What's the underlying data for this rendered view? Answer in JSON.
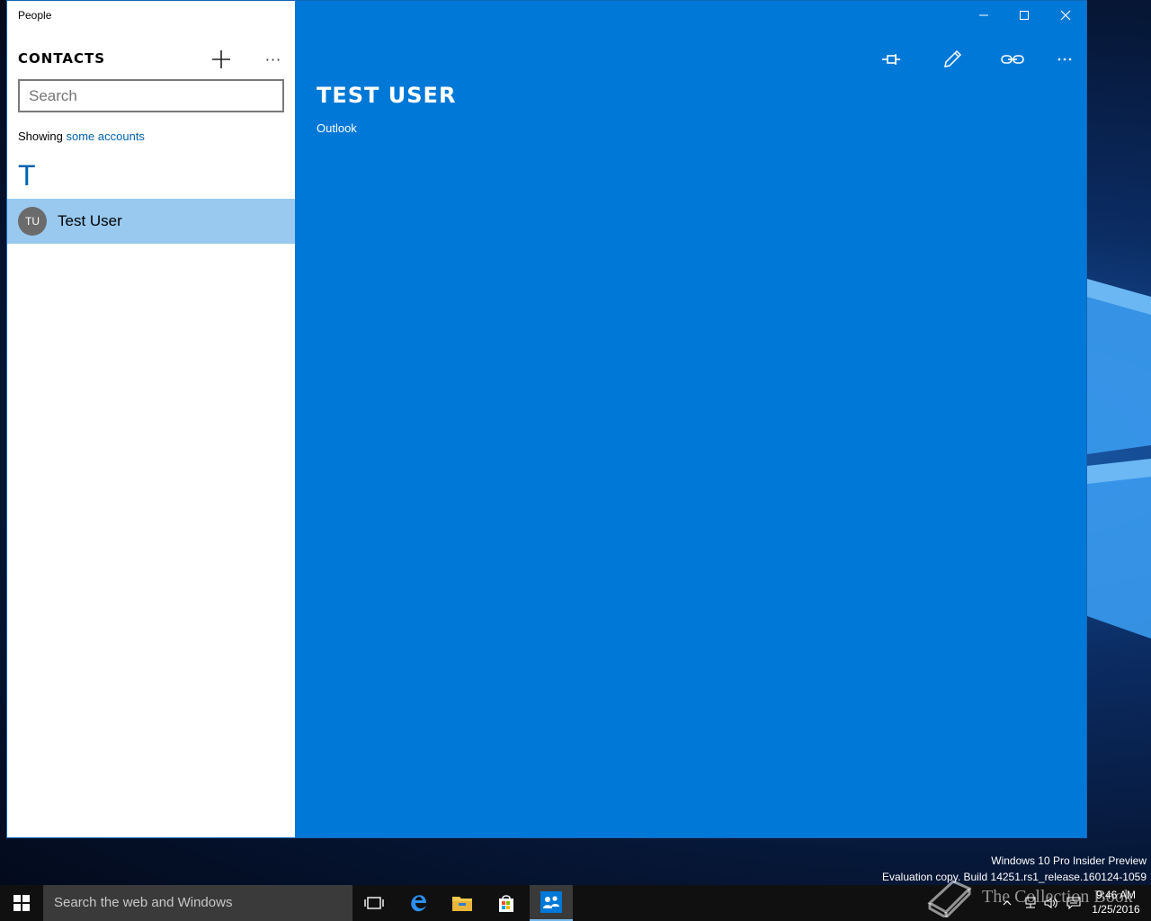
{
  "window": {
    "app_title": "People",
    "controls": [
      "minimize-icon",
      "maximize-icon",
      "close-icon"
    ]
  },
  "contacts_pane": {
    "heading": "CONTACTS",
    "search_placeholder": "Search",
    "showing_prefix": "Showing",
    "showing_link": "some accounts",
    "group_letter": "T",
    "contacts": [
      {
        "initials": "TU",
        "name": "Test User",
        "selected": true
      }
    ]
  },
  "detail_pane": {
    "toolbar": [
      "pin-icon",
      "edit-pencil-icon",
      "link-icon",
      "more-icon"
    ],
    "contact_name": "TEST USER",
    "source": "Outlook",
    "background_color": "#0078d7"
  },
  "desktop": {
    "watermark_line1": "Windows 10 Pro Insider Preview",
    "watermark_line2": "Evaluation copy. Build 14251.rs1_release.160124-1059",
    "overlay_text": "The Collection Book"
  },
  "taskbar": {
    "search_placeholder": "Search the web and Windows",
    "pinned": [
      "task-view-icon",
      "edge-icon",
      "file-explorer-icon",
      "store-icon",
      "people-icon"
    ],
    "clock_time": "9:46 AM",
    "clock_date": "1/25/2016"
  }
}
